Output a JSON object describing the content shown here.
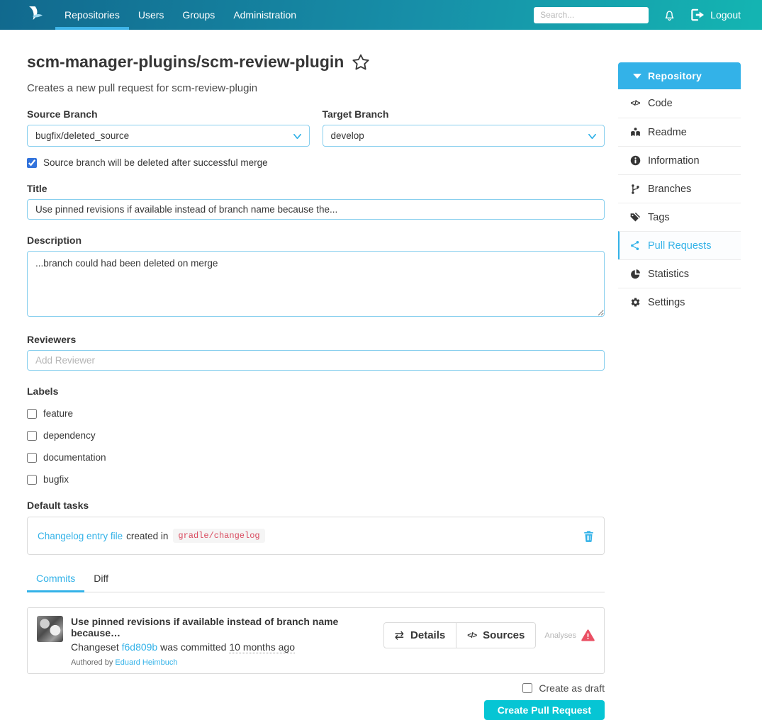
{
  "navbar": {
    "items": [
      {
        "label": "Repositories",
        "active": true
      },
      {
        "label": "Users",
        "active": false
      },
      {
        "label": "Groups",
        "active": false
      },
      {
        "label": "Administration",
        "active": false
      }
    ],
    "search": {
      "placeholder": "Search..."
    },
    "logout_label": "Logout"
  },
  "page": {
    "title": "scm-manager-plugins/scm-review-plugin",
    "subtitle": "Creates a new pull request for scm-review-plugin"
  },
  "form": {
    "source_branch": {
      "label": "Source Branch",
      "value": "bugfix/deleted_source"
    },
    "target_branch": {
      "label": "Target Branch",
      "value": "develop"
    },
    "delete_source": {
      "label": "Source branch will be deleted after successful merge",
      "checked": true
    },
    "title_field": {
      "label": "Title",
      "value": "Use pinned revisions if available instead of branch name because the..."
    },
    "description": {
      "label": "Description",
      "value": "...branch could had been deleted on merge"
    },
    "reviewers": {
      "label": "Reviewers",
      "placeholder": "Add Reviewer"
    },
    "labels": {
      "label": "Labels",
      "options": [
        {
          "label": "feature",
          "checked": false
        },
        {
          "label": "dependency",
          "checked": false
        },
        {
          "label": "documentation",
          "checked": false
        },
        {
          "label": "bugfix",
          "checked": false
        }
      ]
    },
    "default_tasks": {
      "label": "Default tasks",
      "task": {
        "link_text": "Changelog entry file",
        "connector": "created in",
        "path": "gradle/changelog"
      }
    },
    "draft": {
      "label": "Create as draft",
      "checked": false
    },
    "submit_label": "Create Pull Request"
  },
  "tabs": [
    {
      "label": "Commits",
      "active": true
    },
    {
      "label": "Diff",
      "active": false
    }
  ],
  "commit": {
    "title": "Use pinned revisions if available instead of branch name because…",
    "changeset_prefix": "Changeset",
    "changeset_id": "f6d809b",
    "committed_text": "was committed",
    "committed_time": "10 months ago",
    "authored_prefix": "Authored by",
    "author": "Eduard Heimbuch",
    "details_label": "Details",
    "sources_label": "Sources",
    "analyses_label": "Analyses"
  },
  "sidebar": {
    "header": "Repository",
    "items": [
      {
        "label": "Code",
        "icon": "code-icon",
        "active": false
      },
      {
        "label": "Readme",
        "icon": "readme-icon",
        "active": false
      },
      {
        "label": "Information",
        "icon": "information-icon",
        "active": false
      },
      {
        "label": "Branches",
        "icon": "branches-icon",
        "active": false
      },
      {
        "label": "Tags",
        "icon": "tags-icon",
        "active": false
      },
      {
        "label": "Pull Requests",
        "icon": "pull-requests-icon",
        "active": true
      },
      {
        "label": "Statistics",
        "icon": "statistics-icon",
        "active": false
      },
      {
        "label": "Settings",
        "icon": "settings-icon",
        "active": false
      }
    ]
  },
  "glyphs": {
    "code": "</>",
    "exchange": "⇄"
  },
  "colors": {
    "accent": "#33b2e8",
    "navbar_start": "#11698e",
    "navbar_end": "#14b5b2",
    "submit_button": "#06c5d4",
    "checkbox_checked": "#3273dc",
    "code_text": "#d94a5e",
    "warning": "#ea5064",
    "border": "#dbdbdb",
    "input_border": "#88cfee"
  }
}
